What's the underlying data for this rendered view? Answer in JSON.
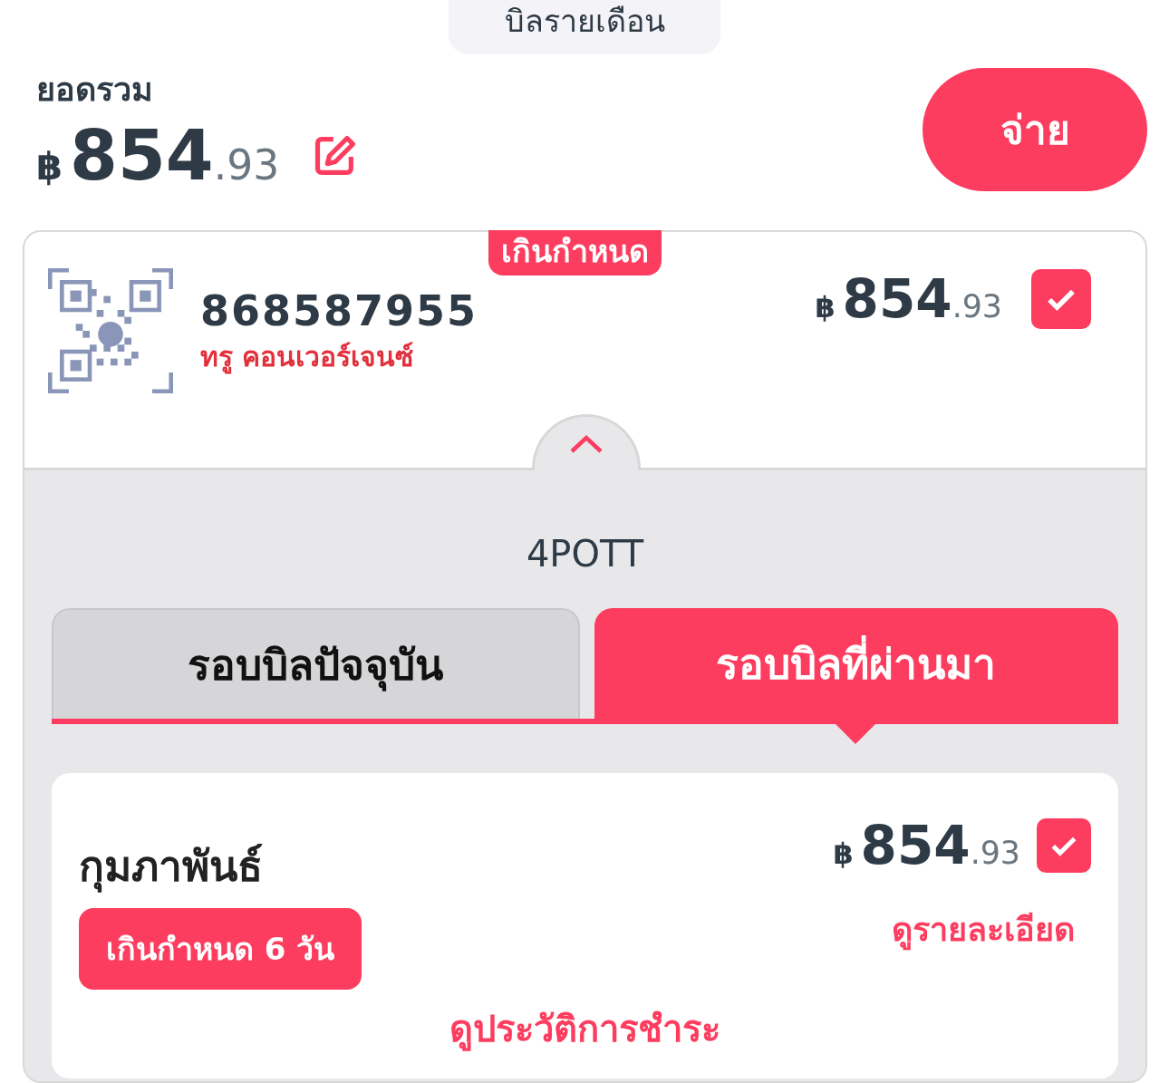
{
  "header": {
    "segment": "บิลรายเดือน",
    "total_label": "ยอดรวม",
    "total": {
      "currency": "฿",
      "whole": "854",
      "fraction": ".93"
    },
    "pay_button": "จ่าย"
  },
  "account": {
    "badge": "เกินกำหนด",
    "number": "868587955",
    "provider": "ทรู คอนเวอร์เจนซ์",
    "amount": {
      "currency": "฿",
      "whole": "854",
      "fraction": ".93"
    },
    "checked": true,
    "expanded": true,
    "name": "4POTT"
  },
  "tabs": [
    {
      "label": "รอบบิลปัจจุบัน",
      "selected": false
    },
    {
      "label": "รอบบิลที่ผ่านมา",
      "selected": true
    }
  ],
  "bills": [
    {
      "month": "กุมภาพันธ์",
      "status": "เกินกำหนด 6 วัน",
      "amount": {
        "currency": "฿",
        "whole": "854",
        "fraction": ".93"
      },
      "checked": true,
      "details_link": "ดูรายละเอียด"
    }
  ],
  "history_link": "ดูประวัติการชำระ"
}
